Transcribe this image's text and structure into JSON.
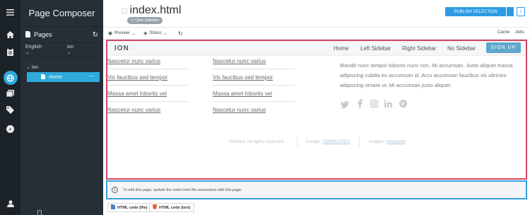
{
  "rail": {
    "icons": [
      "menu-icon",
      "home-icon",
      "clipboard-icon",
      "globe-icon",
      "gallery-icon",
      "tag-icon",
      "compass-icon",
      "user-icon"
    ]
  },
  "composer": {
    "title": "Page Composer",
    "pages_label": "Pages",
    "language": "English",
    "site_select": "ion",
    "tree_site": "ion",
    "tree_home": "Home",
    "tree_home_action": "—"
  },
  "header": {
    "filename": "index.html",
    "clear_selection": "Clear Selection",
    "publish_label": "PUBLISH SELECTION",
    "info_label": "i"
  },
  "toolbar": {
    "preview_label": "Preview",
    "status_label": "Status",
    "cache_label": "Cache",
    "jobs_label": "Jobs"
  },
  "site": {
    "logo": "ION",
    "nav": [
      "Home",
      "Left Sidebar",
      "Right Sidebar",
      "No Sidebar"
    ],
    "signup": "SIGN UP",
    "links_col1": [
      "Nascetur nunc varius",
      "Vis faucibus sed tempor",
      "Massa amet lobortis vel",
      "Nascetur nunc varius"
    ],
    "links_col2": [
      "Nascetur nunc varius",
      "Vis faucibus sed tempor",
      "Massa amet lobortis vel",
      "Nascetur nunc varius"
    ],
    "blurb": "Blandit nunc tempor lobortis nunc non. Mi accumsan. Justo aliquet massa adipiscing cubilia eu accumsan id. Arcu accumsan faucibus vis ultricies adipiscing ornare ut. Mi accumsan justo aliquet.",
    "social": [
      "twitter-icon",
      "facebook-icon",
      "instagram-icon",
      "linkedin-icon",
      "pinterest-icon"
    ],
    "footer_copy": "Untitled. All rights reserved.",
    "footer_design_label": "Design:",
    "footer_design_link": "TEMPLATED",
    "footer_images_label": "Images:",
    "footer_images_link": "Unsplash"
  },
  "notice": {
    "text": "To edit this page, update the index.html file associated with this page."
  },
  "bottom_tabs": {
    "file": "HTML code (file)",
    "text": "HTML code (text)"
  },
  "colors": {
    "rail_bg": "#1b2228",
    "composer_bg": "#262f37",
    "accent": "#2eaadc",
    "publish": "#2d9be3",
    "frame_border": "#d14866",
    "notice_border": "#3aa0e0",
    "signup": "#5fa7cc"
  }
}
